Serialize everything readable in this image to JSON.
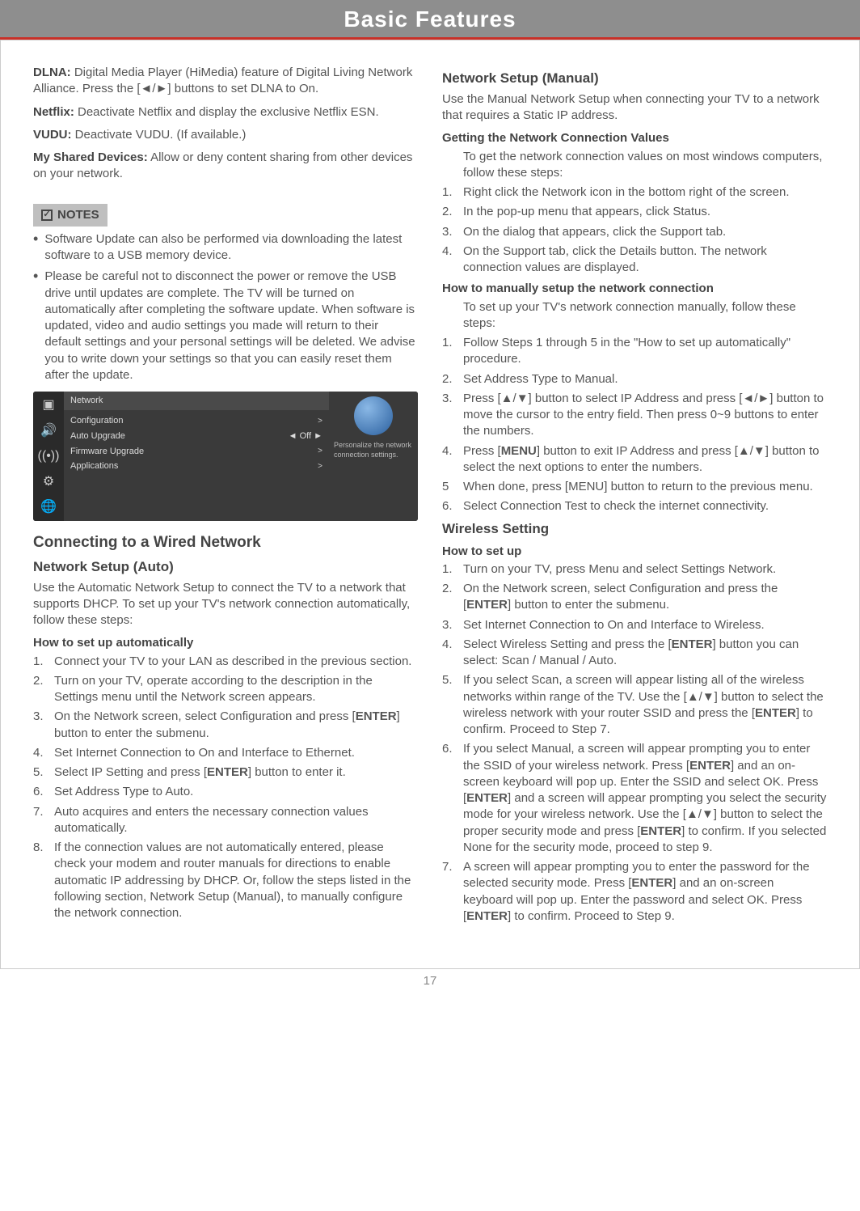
{
  "header": {
    "title": "Basic Features"
  },
  "left": {
    "dlna_label": "DLNA:",
    "dlna_text": " Digital Media Player (HiMedia) feature of Digital Living Network Alliance. Press the [◄/►] buttons to set DLNA to On.",
    "netflix_label": "Netflix:",
    "netflix_text": " Deactivate Netflix and display the exclusive Netflix ESN.",
    "vudu_label": "VUDU:",
    "vudu_text": " Deactivate VUDU. (If available.)",
    "shared_label": "My Shared Devices:",
    "shared_text": " Allow or deny content sharing from other devices on your network.",
    "notes_heading": "NOTES",
    "notes": [
      "Software Update can also be performed via downloading the latest software to a USB memory device.",
      "Please be careful not to disconnect the power or remove the USB drive until updates are complete. The TV will be turned on automatically after completing the software update. When software is updated, video and audio settings you made will return to their default settings and your personal settings will be deleted. We advise you to write down your settings so that you can easily reset them after the update."
    ],
    "menu": {
      "title": "Network",
      "rows": [
        {
          "label": "Configuration",
          "value": "",
          "arrow": ">"
        },
        {
          "label": "Auto Upgrade",
          "value": "Off",
          "arrow": "►"
        },
        {
          "label": "Firmware Upgrade",
          "value": "",
          "arrow": ">"
        },
        {
          "label": "Applications",
          "value": "",
          "arrow": ">"
        }
      ],
      "desc": "Personalize the network connection settings."
    },
    "h_connecting": "Connecting to a Wired Network",
    "h_auto": "Network Setup (Auto)",
    "auto_intro": "Use the Automatic Network Setup to connect the TV to a network that supports DHCP. To set up your TV's network connection automatically, follow these steps:",
    "auto_sub": "How to set up automatically",
    "auto_steps": [
      "Connect your TV to your LAN as described in the previous section.",
      "Turn on your TV, operate according to the description in the Settings menu until the Network screen appears.",
      "On the Network screen, select Configuration and press [ENTER] button to enter the submenu.",
      "Set Internet Connection to On and Interface to Ethernet.",
      "Select IP Setting and press [ENTER] button to enter it.",
      "Set Address Type to Auto.",
      "Auto acquires and enters the necessary connection values automatically.",
      "If the connection values are not automatically entered, please check your modem and router manuals for directions to enable automatic IP addressing by DHCP. Or, follow the steps listed in the following section, Network Setup (Manual), to manually configure the network connection."
    ]
  },
  "right": {
    "h_manual": "Network Setup (Manual)",
    "manual_intro": "Use the Manual Network Setup when connecting your TV to a network that requires a Static IP address.",
    "getting_sub": "Getting the Network Connection Values",
    "getting_intro": "To get the network connection values on most windows computers, follow these steps:",
    "getting_steps": [
      "Right click the Network icon in the bottom right of the screen.",
      "In the pop-up menu that appears, click Status.",
      "On the dialog that appears, click the Support tab.",
      "On the Support tab, click the Details button. The network connection values are displayed."
    ],
    "howto_sub": "How to manually setup the network connection",
    "howto_intro": "To set up your TV's network connection manually, follow these steps:",
    "howto_steps": [
      "Follow Steps 1 through 5 in the \"How to set up automatically\" procedure.",
      "Set Address Type to Manual.",
      "Press [▲/▼] button to select IP Address and press [◄/►] button to move the cursor to the entry field. Then press 0~9 buttons to enter the numbers.",
      "Press [MENU] button to exit IP Address and press [▲/▼] button to select the next options to enter the numbers.",
      "When done, press [MENU] button to return to the previous menu.",
      "Select Connection Test to check the internet connectivity."
    ],
    "h_wireless": "Wireless Setting",
    "wireless_sub": "How to set up",
    "wireless_steps": [
      "Turn on your TV, press Menu and select Settings  Network.",
      "On the Network screen, select Configuration and press the [ENTER] button to enter the submenu.",
      "Set Internet Connection to On and Interface to Wireless.",
      "Select Wireless Setting and press the [ENTER] button you can select: Scan / Manual / Auto.",
      "If you select Scan, a screen will appear listing all of the wireless networks within range of the TV. Use the [▲/▼] button to select the wireless network with your router SSID and press the [ENTER] to confirm. Proceed to Step 7.",
      "If you select Manual, a screen will appear prompting you to enter the SSID of your wireless network. Press [ENTER] and an on-screen keyboard will pop up. Enter the SSID and select OK. Press [ENTER] and a screen will appear prompting you select the security mode for your wireless network. Use the [▲/▼] button to select the proper security mode and press [ENTER] to confirm. If you selected None for the security mode, proceed to step 9.",
      "A screen will appear prompting you to enter the password for the selected security mode. Press [ENTER] and an on-screen keyboard will pop up. Enter the password and select OK. Press [ENTER] to confirm. Proceed to Step 9."
    ]
  },
  "footer": {
    "page": "17"
  }
}
